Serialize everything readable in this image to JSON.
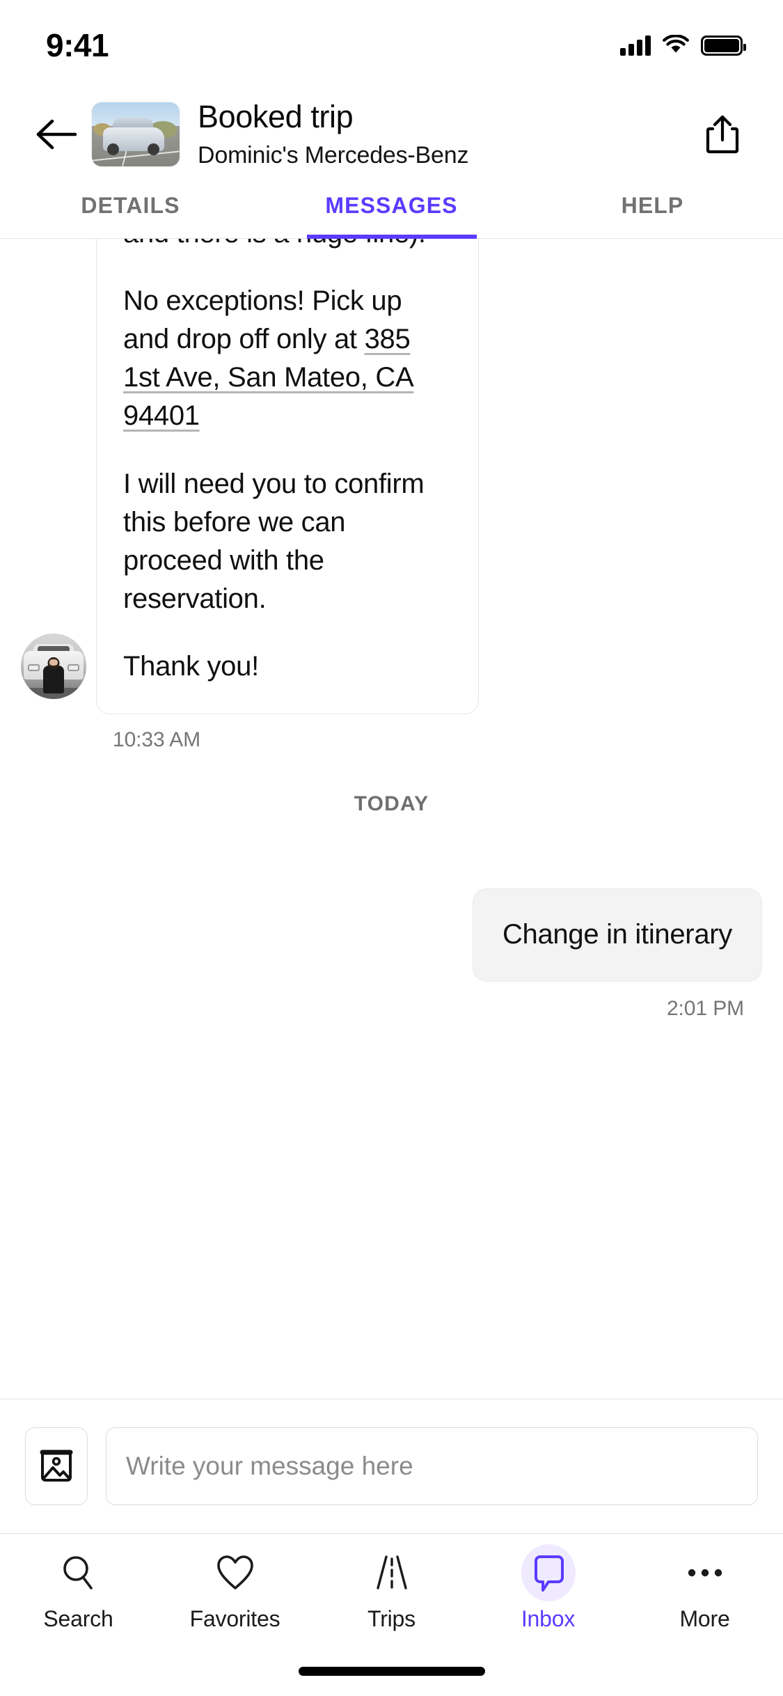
{
  "status_bar": {
    "time": "9:41",
    "cellular_icon": "cellular-bars-icon",
    "wifi_icon": "wifi-icon",
    "battery_icon": "battery-full-icon"
  },
  "nav_header": {
    "back_icon": "back-arrow-icon",
    "vehicle_thumbnail": "vehicle-thumbnail-image",
    "title": "Booked trip",
    "subtitle": "Dominic's Mercedes-Benz",
    "share_icon": "share-icon"
  },
  "tabs": [
    {
      "label": "DETAILS",
      "active": false
    },
    {
      "label": "MESSAGES",
      "active": true
    },
    {
      "label": "HELP",
      "active": false
    }
  ],
  "colors": {
    "accent": "#593cff",
    "tab_inactive": "#717171",
    "bubble_incoming_bg": "#ffffff",
    "bubble_outgoing_bg": "#f3f3f3",
    "timestamp": "#767676",
    "placeholder": "#8b8b8b"
  },
  "thread": {
    "incoming_message": {
      "avatar": "host-avatar-image",
      "paragraph_1": "up/ drop off. (San Francisco Airport does not allow Turo pick up/ drop off and there is a huge fine).",
      "paragraph_2_before": "No exceptions! Pick up and drop off only at ",
      "paragraph_2_link": "385 1st Ave, San Mateo, CA 94401",
      "paragraph_3": "I will need you to confirm this before we can proceed with the reservation.",
      "paragraph_4": "Thank you!",
      "timestamp": "10:33 AM"
    },
    "day_divider": "TODAY",
    "outgoing_message": {
      "text": "Change in itinerary",
      "timestamp": "2:01 PM"
    }
  },
  "composer": {
    "attach_icon": "image-attachment-icon",
    "input_value": "",
    "input_placeholder": "Write your message here"
  },
  "bottom_tabs": [
    {
      "label": "Search",
      "icon": "search-icon",
      "active": false
    },
    {
      "label": "Favorites",
      "icon": "heart-icon",
      "active": false
    },
    {
      "label": "Trips",
      "icon": "road-icon",
      "active": false
    },
    {
      "label": "Inbox",
      "icon": "chat-bubble-icon",
      "active": true
    },
    {
      "label": "More",
      "icon": "ellipsis-icon",
      "active": false
    }
  ],
  "home_indicator": "home-indicator"
}
